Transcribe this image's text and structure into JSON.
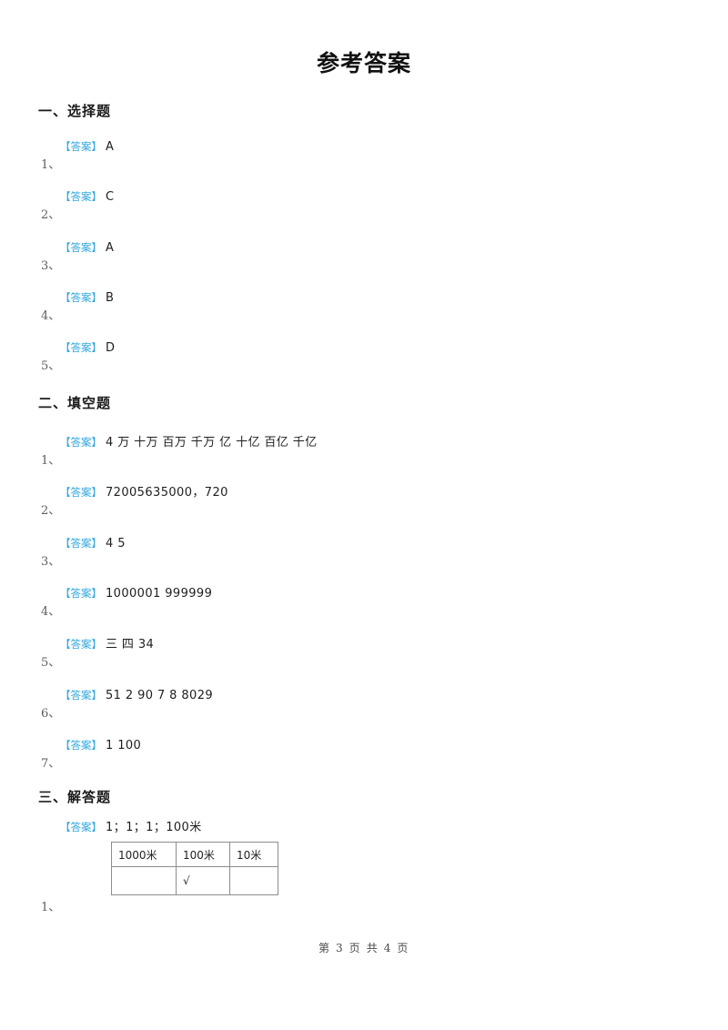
{
  "document": {
    "title": "参考答案",
    "answer_tag": "【答案】",
    "footer": "第 3 页 共 4 页"
  },
  "sections": [
    {
      "heading": "一、选择题",
      "items": [
        {
          "number": "1、",
          "answer": "A"
        },
        {
          "number": "2、",
          "answer": "C"
        },
        {
          "number": "3、",
          "answer": "A"
        },
        {
          "number": "4、",
          "answer": "B"
        },
        {
          "number": "5、",
          "answer": "D"
        }
      ]
    },
    {
      "heading": "二、填空题",
      "items": [
        {
          "number": "1、",
          "answer": "4 万 十万 百万 千万 亿 十亿 百亿 千亿"
        },
        {
          "number": "2、",
          "answer": "72005635000，720"
        },
        {
          "number": "3、",
          "answer": "4 5"
        },
        {
          "number": "4、",
          "answer": "1000001 999999"
        },
        {
          "number": "5、",
          "answer": "三 四 34"
        },
        {
          "number": "6、",
          "answer": "51 2 90 7 8 8029"
        },
        {
          "number": "7、",
          "answer": "1 100"
        }
      ]
    },
    {
      "heading": "三、解答题",
      "items": [
        {
          "number": "1、",
          "answer": "1；1；1；100米",
          "table": {
            "header": [
              "1000米",
              "100米",
              "10米"
            ],
            "row": [
              "",
              "√",
              ""
            ]
          }
        }
      ]
    }
  ],
  "colors": {
    "tag_blue": "#32a7dd",
    "text": "#1f1f1f",
    "number_gray": "#5e5e5e",
    "table_border": "#8d8d8d"
  }
}
